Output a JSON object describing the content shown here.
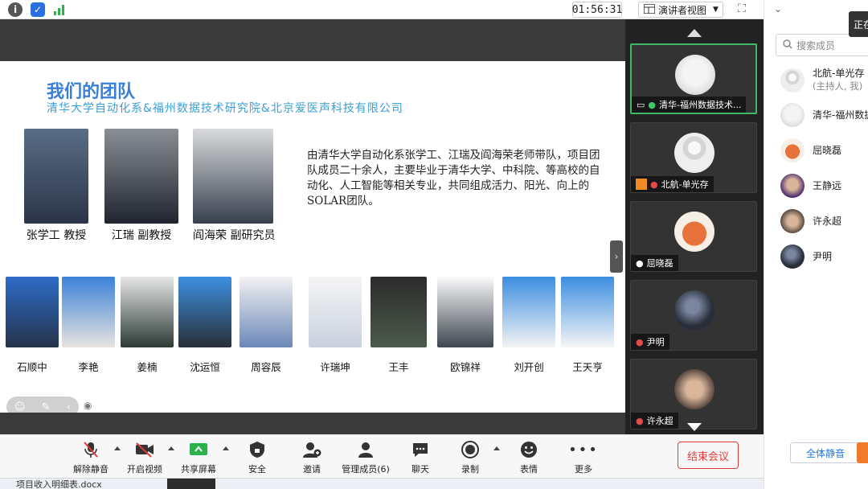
{
  "topbar": {
    "timer": "01:56:31",
    "view_label": "演讲者视图",
    "icons": [
      "info-icon",
      "shield-icon",
      "signal-icon"
    ]
  },
  "slide": {
    "title": "我们的团队",
    "subtitle": "清华大学自动化系&福州数据技术研究院&北京爱医声科技有限公司",
    "intro": "由清华大学自动化系张学工、江瑞及阎海荣老师带队，项目团队成员二十余人，主要毕业于清华大学、中科院、等高校的自动化、人工智能等相关专业，共同组成活力、阳光、向上的SOLAR团队。",
    "professors": [
      {
        "name": "张学工 教授"
      },
      {
        "name": "江瑞 副教授"
      },
      {
        "name": "阎海荣 副研究员"
      }
    ],
    "students": [
      {
        "name": "石顺中"
      },
      {
        "name": "李艳"
      },
      {
        "name": "姜楠"
      },
      {
        "name": "沈运恒"
      },
      {
        "name": "周容辰"
      },
      {
        "name": "许瑞坤"
      },
      {
        "name": "王丰"
      },
      {
        "name": "欧锦祥"
      },
      {
        "name": "刘开创"
      },
      {
        "name": "王天亨"
      }
    ]
  },
  "videos": [
    {
      "label": "清华-福州数据技术..."
    },
    {
      "label": "北航-单光存"
    },
    {
      "label": "屈晓磊"
    },
    {
      "label": "尹明"
    },
    {
      "label": "许永超"
    }
  ],
  "members": {
    "search_placeholder": "搜索成员",
    "tag": "正在",
    "list": [
      {
        "name": "北航-单光存",
        "sub": "(主持人, 我)"
      },
      {
        "name": "清华-福州数据",
        "sub": ""
      },
      {
        "name": "屈晓磊",
        "sub": ""
      },
      {
        "name": "王静远",
        "sub": ""
      },
      {
        "name": "许永超",
        "sub": ""
      },
      {
        "name": "尹明",
        "sub": ""
      }
    ],
    "mute_all": "全体静音"
  },
  "toolbar": {
    "unmute": "解除静音",
    "video": "开启视频",
    "share": "共享屏幕",
    "security": "安全",
    "invite": "邀请",
    "manage": "管理成员(6)",
    "chat": "聊天",
    "record": "录制",
    "reaction": "表情",
    "more": "更多",
    "end": "结束会议"
  },
  "taskbar": {
    "item": "项目收入明细表.docx"
  }
}
